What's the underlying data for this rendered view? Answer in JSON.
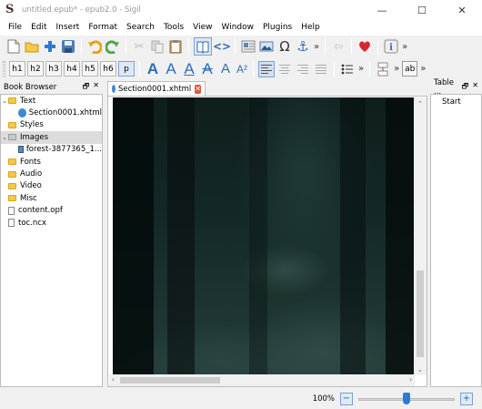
{
  "window": {
    "title": "untitled.epub* - epub2.0 - Sigil",
    "app_glyph": "S",
    "minimize": "—",
    "maximize": "☐",
    "close": "✕"
  },
  "menu": [
    "File",
    "Edit",
    "Insert",
    "Format",
    "Search",
    "Tools",
    "View",
    "Window",
    "Plugins",
    "Help"
  ],
  "toolbar": {
    "more": "»",
    "headings": [
      "h1",
      "h2",
      "h3",
      "h4",
      "h5",
      "h6",
      "p"
    ],
    "font_sizes": [
      "A",
      "A",
      "A",
      "A",
      "A"
    ],
    "superscript": "A²",
    "list_more": "»",
    "ab_label": "ab"
  },
  "book_browser": {
    "title": "Book Browser",
    "float": "🗗",
    "close": "✕",
    "items": [
      {
        "label": "Text",
        "kind": "folder",
        "expanded": true,
        "level": 0
      },
      {
        "label": "Section0001.xhtml",
        "kind": "html",
        "level": 1
      },
      {
        "label": "Styles",
        "kind": "folder",
        "level": 0
      },
      {
        "label": "Images",
        "kind": "folder",
        "expanded": true,
        "level": 0,
        "selected": true
      },
      {
        "label": "forest-3877365_1...",
        "kind": "image",
        "level": 1
      },
      {
        "label": "Fonts",
        "kind": "folder",
        "level": 0
      },
      {
        "label": "Audio",
        "kind": "folder",
        "level": 0
      },
      {
        "label": "Video",
        "kind": "folder",
        "level": 0
      },
      {
        "label": "Misc",
        "kind": "folder",
        "level": 0
      },
      {
        "label": "content.opf",
        "kind": "file",
        "level": 0
      },
      {
        "label": "toc.ncx",
        "kind": "file",
        "level": 0
      }
    ]
  },
  "editor": {
    "tab_label": "Section0001.xhtml",
    "tab_close": "✕"
  },
  "toc": {
    "title": "Table ...",
    "float": "🗗",
    "close": "✕",
    "items": [
      "Start"
    ]
  },
  "status": {
    "zoom": "100%",
    "zoom_out": "−",
    "zoom_in": "+",
    "zoom_fraction": 0.5
  }
}
